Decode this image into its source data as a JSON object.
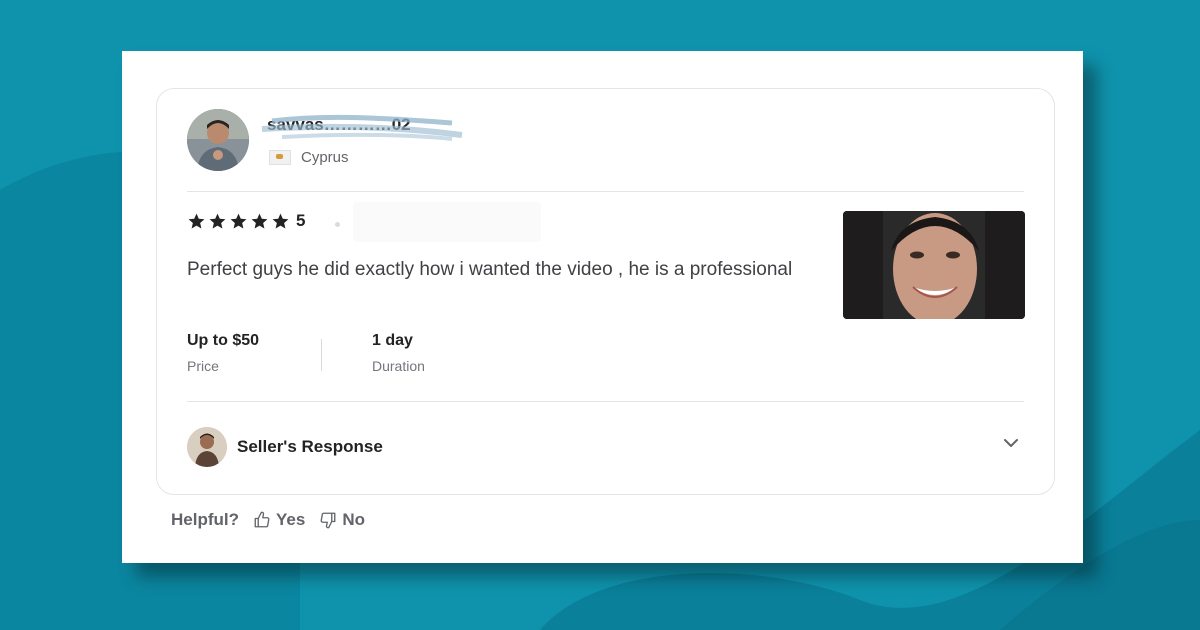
{
  "review": {
    "username": "savvas…………02",
    "country": "Cyprus",
    "rating_value": "5",
    "stars": 5,
    "text": "Perfect guys he did exactly how i wanted the video , he is a professional",
    "price_value": "Up to $50",
    "price_label": "Price",
    "duration_value": "1 day",
    "duration_label": "Duration"
  },
  "seller_response": {
    "label": "Seller's Response"
  },
  "helpful": {
    "label": "Helpful?",
    "yes_label": "Yes",
    "no_label": "No"
  },
  "colors": {
    "background": "#0f93ad",
    "card": "#ffffff",
    "text_primary": "#222325",
    "text_secondary": "#62646a"
  },
  "icons": {
    "star": "star-icon",
    "chevron": "chevron-down-icon",
    "thumb_up": "thumb-up-icon",
    "thumb_down": "thumb-down-icon",
    "flag": "cyprus-flag-icon"
  }
}
